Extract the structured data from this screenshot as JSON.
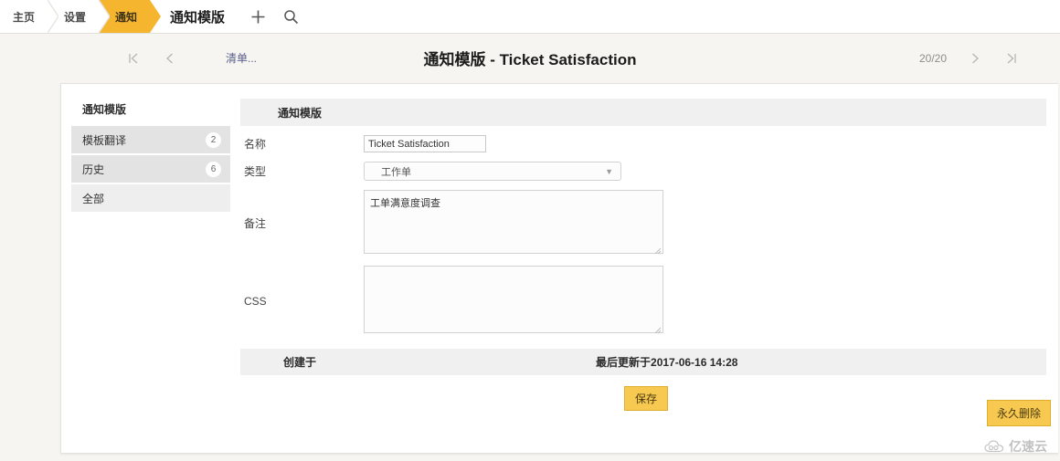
{
  "topbar": {
    "breadcrumbs": [
      {
        "label": "主页",
        "active": false
      },
      {
        "label": "设置",
        "active": false
      },
      {
        "label": "通知",
        "active": true
      }
    ],
    "title": "通知模版",
    "add_icon": "plus-icon",
    "search_icon": "search-icon",
    "accent_color": "#f5b52e"
  },
  "subheader": {
    "first_icon": "first-page-icon",
    "prev_icon": "previous-page-icon",
    "list_link": "清单...",
    "page_title": "通知模版 - Ticket Satisfaction",
    "pager_count": "20/20",
    "next_icon": "next-page-icon",
    "last_icon": "last-page-icon"
  },
  "sidebar": {
    "heading": "通知模版",
    "items": [
      {
        "label": "模板翻译",
        "badge": "2"
      },
      {
        "label": "历史",
        "badge": "6"
      },
      {
        "label": "全部",
        "badge": ""
      }
    ]
  },
  "form": {
    "panel_title": "通知模版",
    "fields": {
      "name_label": "名称",
      "name_value": "Ticket Satisfaction",
      "type_label": "类型",
      "type_value": "工作单",
      "notes_label": "备注",
      "notes_value": "工单满意度调查",
      "css_label": "CSS",
      "css_value": ""
    },
    "meta": {
      "created_label": "创建于",
      "updated_label": "最后更新于2017-06-16 14:28"
    },
    "save_button": "保存"
  },
  "actions": {
    "delete_button": "永久删除",
    "button_color": "#f7c950"
  },
  "watermark": {
    "text": "亿速云",
    "icon": "cloud-icon"
  }
}
